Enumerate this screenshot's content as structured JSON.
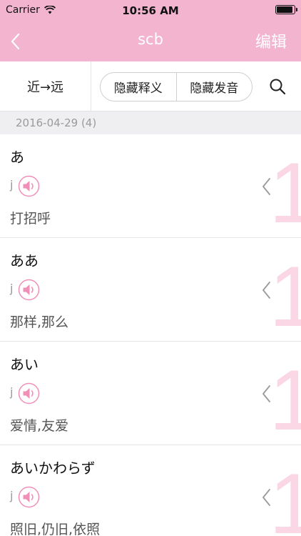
{
  "status_bar": {
    "carrier": "Carrier",
    "time": "10:56 AM",
    "battery_level": 0.9
  },
  "nav": {
    "title": "scb",
    "edit_label": "编辑"
  },
  "toolbar": {
    "sort_label": "近→远",
    "hide_meaning_label": "隐藏释义",
    "hide_pronunciation_label": "隐藏发音"
  },
  "section": {
    "header": "2016-04-29 (4)"
  },
  "entries": [
    {
      "word": "あ",
      "reading": "j",
      "meaning": "打招呼",
      "count": "1"
    },
    {
      "word": "ああ",
      "reading": "j",
      "meaning": "那样,那么",
      "count": "1"
    },
    {
      "word": "あい",
      "reading": "j",
      "meaning": "爱情,友爱",
      "count": "1"
    },
    {
      "word": "あいかわらず",
      "reading": "j",
      "meaning": "照旧,仍旧,依照",
      "count": "1"
    }
  ],
  "colors": {
    "accent": "#f2b4cf",
    "speaker_pink": "#f08fb8",
    "count_watermark": "#fbd6e4"
  },
  "icons": [
    "wifi-icon",
    "battery-icon",
    "back-arrow-icon",
    "search-icon",
    "speaker-icon",
    "chevron-left-icon"
  ]
}
